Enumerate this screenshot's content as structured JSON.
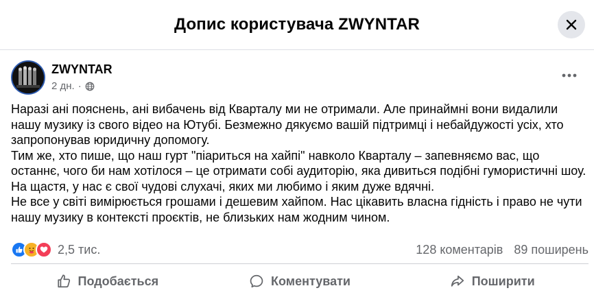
{
  "header": {
    "title": "Допис користувача ZWYNTAR"
  },
  "post": {
    "author": "ZWYNTAR",
    "time": "2 дн.",
    "separator": "·",
    "paragraphs": [
      "Наразі ані пояснень, ані вибачень від Кварталу ми не отримали. Але принаймні вони видалили нашу музику із свого відео на Ютубі. Безмежно дякуємо вашій підтримці і небайдужості усіх, хто запропонував юридичну допомогу.",
      "Тим же, хто пише, що наш гурт \"піариться на хайпі\" навколо Кварталу – запевняємо вас, що останнє, чого би нам хотілося – це отримати собі аудиторію, яка дивиться подібні гумористичні шоу. На щастя, у нас є свої чудові слухачі, яких ми любимо і яким дуже вдячні.",
      "Не все у світі вимірюється грошами і дешевим хайпом. Нас цікавить власна гідність і право не чути нашу музику в контексті проєктів, не близьких нам жодним чином."
    ]
  },
  "reactions": {
    "count": "2,5 тис.",
    "comments": "128 коментарів",
    "shares": "89 поширень",
    "icons": [
      "like-reaction",
      "care-reaction",
      "love-reaction"
    ]
  },
  "actions": {
    "like": "Подобається",
    "comment": "Коментувати",
    "share": "Поширити"
  },
  "colors": {
    "like_blue": "#1877f2",
    "love_red": "#f33e58",
    "care_yellow": "#f7b125",
    "secondary_text": "#65676b"
  }
}
